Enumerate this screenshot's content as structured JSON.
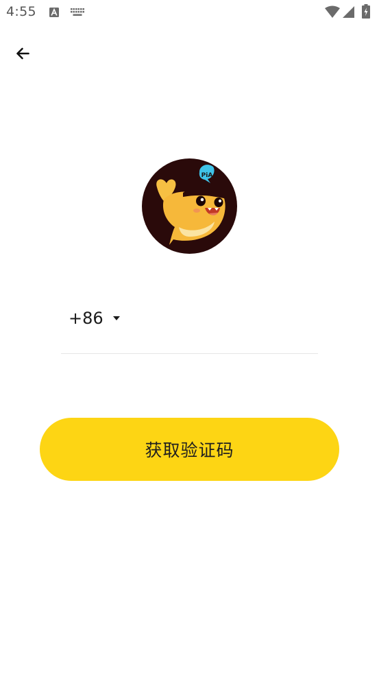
{
  "status_bar": {
    "time": "4:55",
    "icons": [
      "a-notification-icon",
      "keyboard-icon",
      "wifi-icon",
      "signal-icon",
      "battery-icon"
    ]
  },
  "header": {
    "back_icon": "arrow-left-icon"
  },
  "logo": {
    "badge_text": "PiA"
  },
  "phone": {
    "country_code": "+86",
    "dropdown_icon": "caret-down-icon",
    "value": "",
    "placeholder": ""
  },
  "actions": {
    "get_code_label": "获取验证码"
  },
  "colors": {
    "accent": "#fdd514",
    "logo_bg": "#2a0a0a",
    "whale_body": "#f6b83a",
    "bubble": "#3fc3e8",
    "divider": "#e6e6e6"
  }
}
